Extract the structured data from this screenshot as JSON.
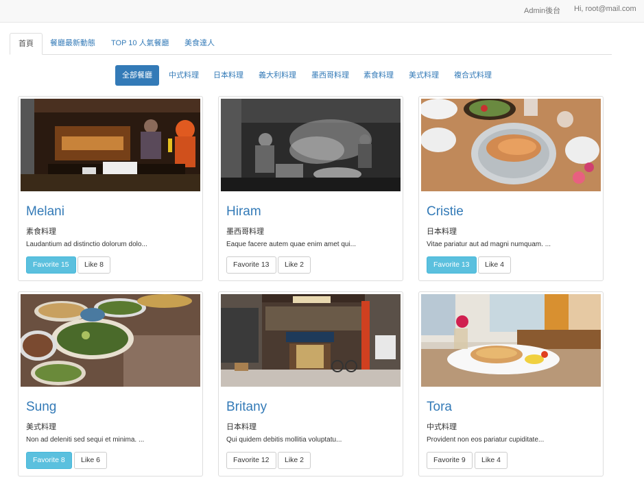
{
  "topbar": {
    "admin_link": "Admin後台",
    "greeting": "Hi, root@mail.com"
  },
  "tabs": [
    {
      "label": "首頁",
      "active": true
    },
    {
      "label": "餐廳最新動態",
      "active": false
    },
    {
      "label": "TOP 10 人氣餐廳",
      "active": false
    },
    {
      "label": "美食達人",
      "active": false
    }
  ],
  "categories": [
    {
      "label": "全部餐廳",
      "active": true
    },
    {
      "label": "中式料理",
      "active": false
    },
    {
      "label": "日本料理",
      "active": false
    },
    {
      "label": "義大利料理",
      "active": false
    },
    {
      "label": "墨西哥料理",
      "active": false
    },
    {
      "label": "素食料理",
      "active": false
    },
    {
      "label": "美式料理",
      "active": false
    },
    {
      "label": "複合式料理",
      "active": false
    }
  ],
  "restaurants": [
    {
      "name": "Melani",
      "category": "素食料理",
      "description": "Laudantium ad distinctio dolorum dolo...",
      "favorite_label": "Favorite 15",
      "favorited": true,
      "like_label": "Like 8",
      "photo": "street-food-stall"
    },
    {
      "name": "Hiram",
      "category": "墨西哥料理",
      "description": "Eaque facere autem quae enim amet qui...",
      "favorite_label": "Favorite 13",
      "favorited": false,
      "like_label": "Like 2",
      "photo": "bw-kitchen"
    },
    {
      "name": "Cristie",
      "category": "日本料理",
      "description": "Vitae pariatur aut ad magni numquam. ...",
      "favorite_label": "Favorite 13",
      "favorited": true,
      "like_label": "Like 4",
      "photo": "table-dish"
    },
    {
      "name": "Sung",
      "category": "美式料理",
      "description": "Non ad deleniti sed sequi et minima. ...",
      "favorite_label": "Favorite 8",
      "favorited": true,
      "like_label": "Like 6",
      "photo": "salad-bowls"
    },
    {
      "name": "Britany",
      "category": "日本料理",
      "description": "Qui quidem debitis mollitia voluptatu...",
      "favorite_label": "Favorite 12",
      "favorited": false,
      "like_label": "Like 2",
      "photo": "storefront"
    },
    {
      "name": "Tora",
      "category": "中式料理",
      "description": "Provident non eos pariatur cupiditate...",
      "favorite_label": "Favorite 9",
      "favorited": false,
      "like_label": "Like 4",
      "photo": "bagel-plate"
    }
  ],
  "colors": {
    "link": "#337ab7",
    "active_pill": "#337ab7",
    "favorite_active": "#5bc0de"
  }
}
